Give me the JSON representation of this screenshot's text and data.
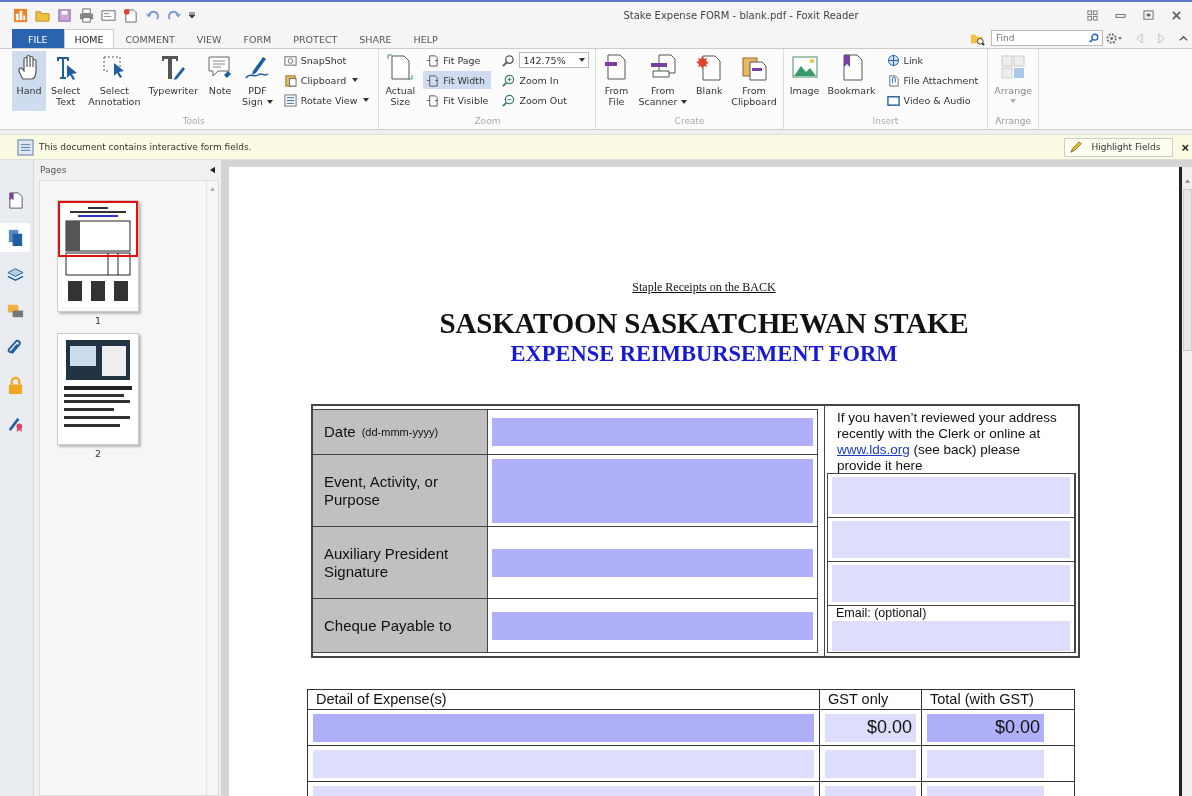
{
  "window": {
    "title": "Stake Expense FORM - blank.pdf - Foxit Reader"
  },
  "menu_tabs": [
    {
      "label": "FILE",
      "kind": "file",
      "selected": false
    },
    {
      "label": "HOME",
      "kind": "tab",
      "selected": true
    },
    {
      "label": "COMMENT",
      "kind": "tab",
      "selected": false
    },
    {
      "label": "VIEW",
      "kind": "tab",
      "selected": false
    },
    {
      "label": "FORM",
      "kind": "tab",
      "selected": false
    },
    {
      "label": "PROTECT",
      "kind": "tab",
      "selected": false
    },
    {
      "label": "SHARE",
      "kind": "tab",
      "selected": false
    },
    {
      "label": "HELP",
      "kind": "tab",
      "selected": false
    }
  ],
  "find": {
    "placeholder": "Find"
  },
  "ribbon": {
    "tools": {
      "label": "Tools",
      "large": [
        {
          "lines": [
            "Hand"
          ],
          "selected": true
        },
        {
          "lines": [
            "Select",
            "Text"
          ],
          "selected": false
        },
        {
          "lines": [
            "Select",
            "Annotation"
          ],
          "selected": false
        },
        {
          "lines": [
            "Typewriter"
          ],
          "selected": false
        },
        {
          "lines": [
            "Note"
          ],
          "selected": false
        },
        {
          "lines": [
            "PDF",
            "Sign"
          ],
          "selected": false,
          "dropdown": true
        }
      ],
      "small": [
        {
          "label": "SnapShot",
          "dropdown": false
        },
        {
          "label": "Clipboard",
          "dropdown": true
        },
        {
          "label": "Rotate View",
          "dropdown": true
        }
      ]
    },
    "zoom": {
      "label": "Zoom",
      "actual": [
        "Actual",
        "Size"
      ],
      "fit": [
        {
          "label": "Fit Page",
          "selected": false
        },
        {
          "label": "Fit Width",
          "selected": true
        },
        {
          "label": "Fit Visible",
          "selected": false
        }
      ],
      "value": "142.75%",
      "buttons": [
        "Zoom In",
        "Zoom Out"
      ]
    },
    "create": {
      "label": "Create",
      "items": [
        {
          "lines": [
            "From",
            "File"
          ],
          "dropdown": false
        },
        {
          "lines": [
            "From",
            "Scanner"
          ],
          "dropdown": true
        },
        {
          "lines": [
            "Blank"
          ],
          "dropdown": false
        },
        {
          "lines": [
            "From",
            "Clipboard"
          ],
          "dropdown": false
        }
      ]
    },
    "insert": {
      "label": "Insert",
      "large": [
        [
          "Image"
        ],
        [
          "Bookmark"
        ]
      ],
      "small": [
        "Link",
        "File Attachment",
        "Video & Audio"
      ]
    },
    "arrange": {
      "label": "Arrange",
      "button": "Arrange",
      "disabled": true
    }
  },
  "info_bar": {
    "message": "This document contains interactive form fields.",
    "button": "Highlight Fields",
    "close": "×"
  },
  "sidebar_tabs": [
    {
      "selected": false
    },
    {
      "selected": true
    },
    {
      "selected": false
    },
    {
      "selected": false
    },
    {
      "selected": false
    },
    {
      "selected": false
    },
    {
      "selected": false
    }
  ],
  "pages_panel": {
    "title": "Pages",
    "thumbnails": [
      {
        "label": "1",
        "selected": true
      },
      {
        "label": "2",
        "selected": false
      }
    ]
  },
  "document": {
    "note": "Staple Receipts on the BACK",
    "title": "SASKATOON SASKATCHEWAN STAKE",
    "subtitle": "EXPENSE REIMBURSEMENT FORM",
    "info_rows": [
      {
        "label": "Date",
        "hint": "(dd-mmm-yyyy)",
        "required": true
      },
      {
        "label": "Event, Activity, or Purpose",
        "required": true
      },
      {
        "label": "Auxiliary President Signature",
        "required": true
      },
      {
        "label": "Cheque Payable to",
        "required": true
      }
    ],
    "address": {
      "before": "If you haven’t reviewed your address recently with the Clerk or online at",
      "link": "www.lds.org",
      "after": "(see back)  please provide it here",
      "fields": [
        {
          "required": false
        },
        {
          "required": false
        },
        {
          "required": false
        }
      ],
      "email_label": "Email: (optional)",
      "email_required": false
    },
    "expenses": {
      "columns": [
        "Detail of Expense(s)",
        "GST only",
        "Total (with GST)"
      ],
      "rows": [
        {
          "cells": [
            {
              "required": true
            },
            {
              "value": "$0.00",
              "required": false
            },
            {
              "value": "$0.00",
              "required": true
            }
          ]
        },
        {
          "cells": [
            {
              "required": false
            },
            {
              "required": false
            },
            {
              "required": false
            }
          ]
        },
        {
          "cells": [
            {
              "required": false
            },
            {
              "required": false
            },
            {
              "required": false
            }
          ]
        }
      ]
    }
  }
}
